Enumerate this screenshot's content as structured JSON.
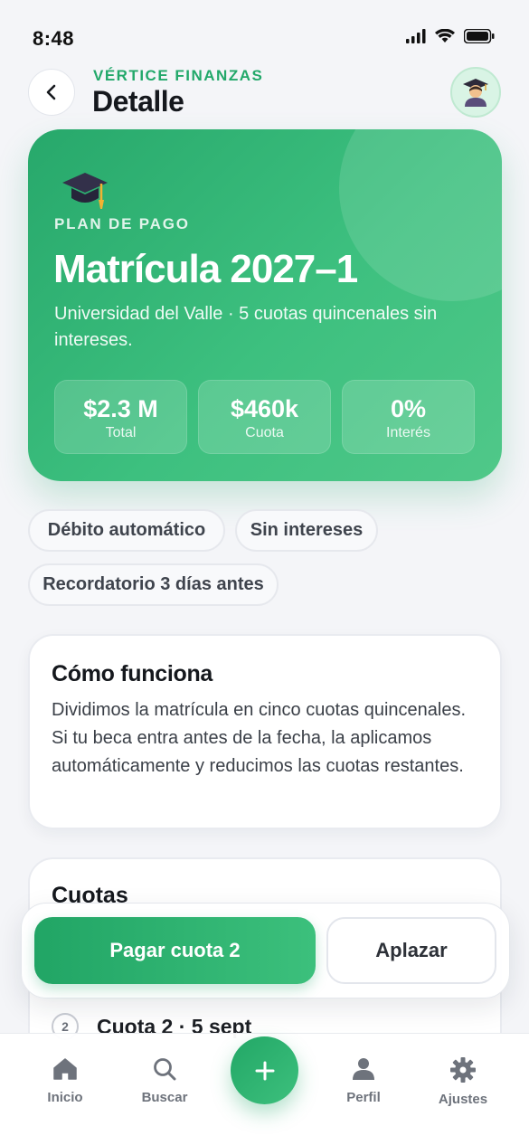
{
  "status_bar": {
    "time": "8:48"
  },
  "header": {
    "brand": "VÉRTICE FINANZAS",
    "title": "Detalle"
  },
  "hero": {
    "kicker": "PLAN DE PAGO",
    "title": "Matrícula 2027–1",
    "description": "Universidad del Valle · 5 cuotas quincenales sin intereses.",
    "stats": [
      {
        "value": "$2.3 M",
        "label": "Total"
      },
      {
        "value": "$460k",
        "label": "Cuota"
      },
      {
        "value": "0%",
        "label": "Interés"
      }
    ]
  },
  "chips": [
    "Débito automático",
    "Sin intereses",
    "Recordatorio 3 días antes"
  ],
  "how": {
    "title": "Cómo funciona",
    "text": "Dividimos la matrícula en cinco cuotas quincenales. Si tu beca entra antes de la fecha, la aplicamos automáticamente y reducimos las cuotas restantes."
  },
  "cuotas": {
    "title": "Cuotas",
    "visible_row": {
      "number": "2",
      "label": "Cuota 2 · 5 sept"
    }
  },
  "actions": {
    "primary": "Pagar cuota 2",
    "secondary": "Aplazar"
  },
  "nav": {
    "items": [
      {
        "label": "Inicio",
        "icon": "home-icon"
      },
      {
        "label": "Buscar",
        "icon": "search-icon"
      },
      {
        "label": "Perfil",
        "icon": "person-icon"
      },
      {
        "label": "Ajustes",
        "icon": "gear-icon"
      }
    ],
    "fab_icon": "plus-icon"
  },
  "colors": {
    "accent": "#2bb06f",
    "background": "#f4f5f8"
  }
}
